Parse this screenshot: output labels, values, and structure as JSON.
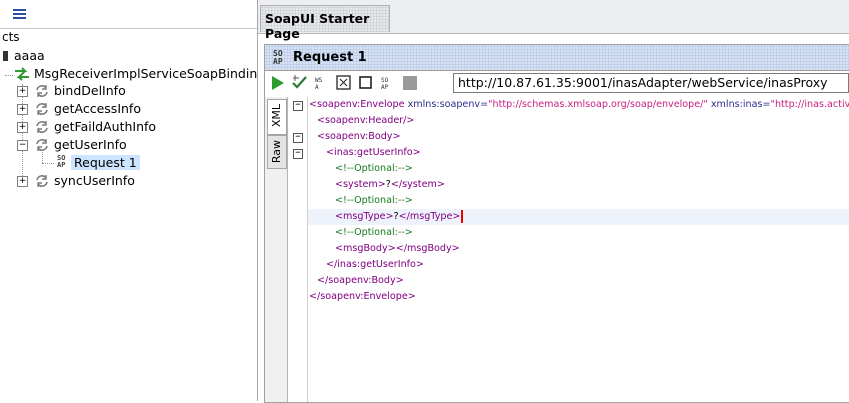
{
  "left_panel": {
    "header": "cts",
    "project_name": "aaaa",
    "interface_name": "MsgReceiverImplServiceSoapBinding",
    "operations": [
      {
        "label": "bindDelInfo",
        "expanded": false
      },
      {
        "label": "getAccessInfo",
        "expanded": false
      },
      {
        "label": "getFaildAuthInfo",
        "expanded": false
      },
      {
        "label": "getUserInfo",
        "expanded": true
      },
      {
        "label": "syncUserInfo",
        "expanded": false
      }
    ],
    "request_item": {
      "label": "Request 1",
      "icon_top": "SO",
      "icon_bottom": "AP"
    }
  },
  "tab": {
    "title": "SoapUI Starter Page"
  },
  "request": {
    "logo_top": "SO",
    "logo_bottom": "AP",
    "title": "Request 1",
    "endpoint_url": "http://10.87.61.35:9001/inasAdapter/webService/inasProxy",
    "vertical_tabs": {
      "xml": "XML",
      "raw": "Raw"
    },
    "xml_lines": [
      {
        "open": "<",
        "tag": "soapenv:Envelope",
        "attr1": "xmlns:soapenv",
        "eq1": "=",
        "val1": "\"http://schemas.xmlsoap.org/soap/envelope/\"",
        "attr2": "xmlns:inas",
        "eq2": "=",
        "val2": "\"http://inas.active.",
        "close": ""
      },
      {
        "text": "<soapenv:Header/>"
      },
      {
        "text": "<soapenv:Body>"
      },
      {
        "text": "<inas:getUserInfo>"
      },
      {
        "text": "<!--Optional:-->"
      },
      {
        "open_tag": "<system>",
        "value": "?",
        "close_tag": "</system>"
      },
      {
        "text": "<!--Optional:-->"
      },
      {
        "open_tag": "<msgType>",
        "value": "?",
        "close_tag": "</msgType>"
      },
      {
        "text": "<!--Optional:-->"
      },
      {
        "open_tag": "<msgBody>",
        "value": "",
        "close_tag": "</msgBody>"
      },
      {
        "text": "</inas:getUserInfo>"
      },
      {
        "text": "</soapenv:Body>"
      },
      {
        "text": "</soapenv:Envelope>"
      }
    ]
  },
  "icons": {
    "list": "list-icon",
    "run": "run-icon",
    "validate": "validate-icon",
    "wsa": "wsa-icon",
    "format": "format-icon",
    "stop": "stop-icon",
    "settings": "settings-icon",
    "cancel": "cancel-icon"
  },
  "colors": {
    "tag": "#800080",
    "attr": "#2d2d8a",
    "value": "#c81e82",
    "comment": "#1a7a1a",
    "run_green": "#2f9a2f",
    "selection": "#cce4ff"
  }
}
